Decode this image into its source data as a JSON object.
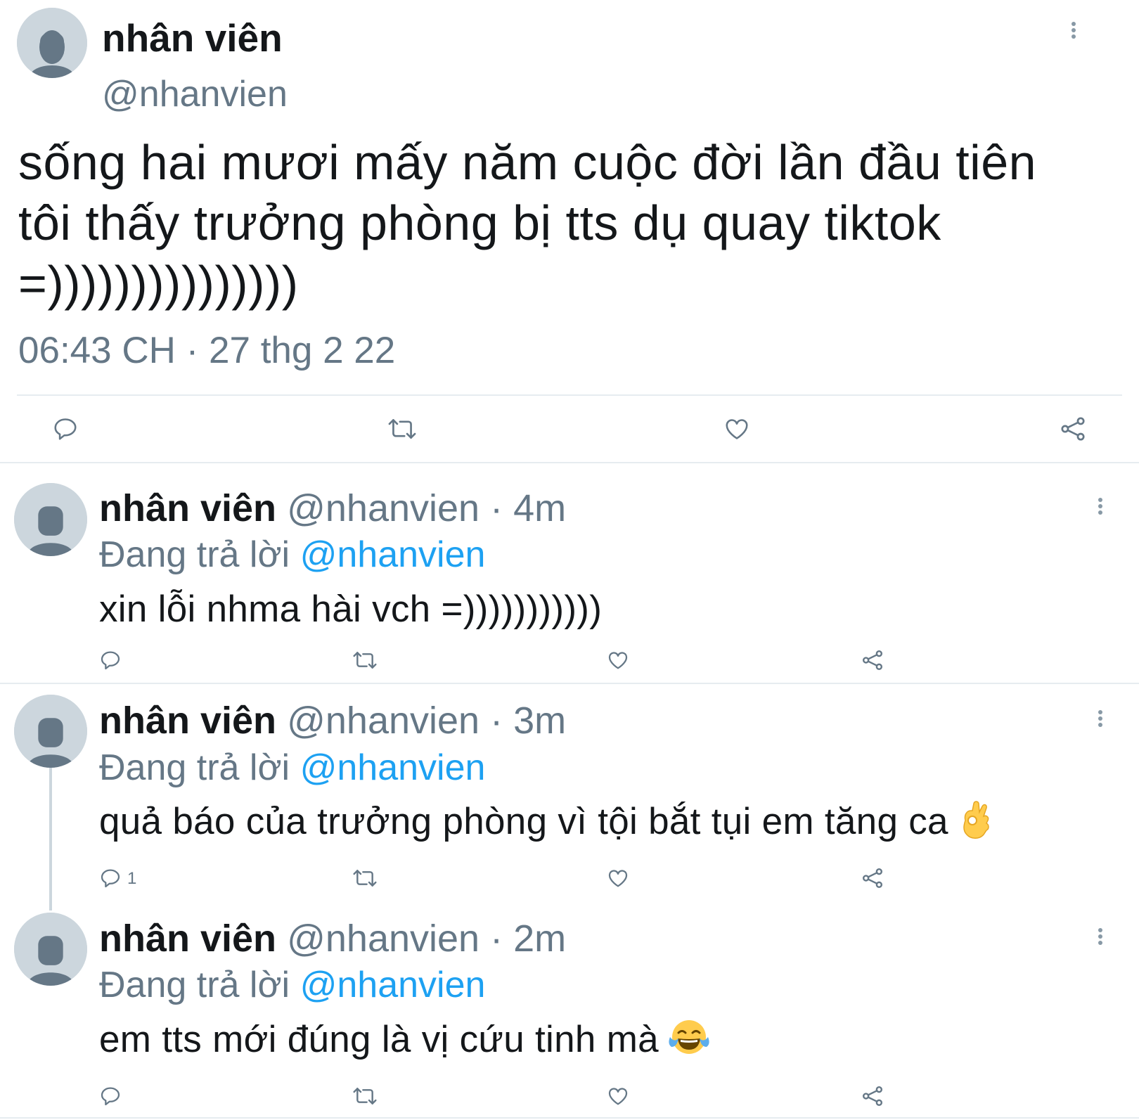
{
  "main_tweet": {
    "name": "nhân viên",
    "handle": "@nhanvien",
    "text_lines": [
      "sống hai mươi mấy năm cuộc đời lần đầu tiên",
      "tôi thấy trưởng phòng bị tts dụ quay tiktok",
      "=)))))))))))))))"
    ],
    "time": "06:43 CH",
    "separator": " · ",
    "date": "27 thg 2 22"
  },
  "replies": [
    {
      "name": "nhân viên",
      "handle": "@nhanvien",
      "separator": " · ",
      "time": "4m",
      "replying_label": "Đang trả lời",
      "replying_to": "@nhanvien",
      "text": "xin lỗi nhma hài vch =)))))))))))",
      "reply_count": ""
    },
    {
      "name": "nhân viên",
      "handle": "@nhanvien",
      "separator": " · ",
      "time": "3m",
      "replying_label": "Đang trả lời",
      "replying_to": "@nhanvien",
      "text": "quả báo của trưởng phòng vì tội bắt tụi em tăng ca",
      "emoji": "ok-hand-emoji",
      "reply_count": "1"
    },
    {
      "name": "nhân viên",
      "handle": "@nhanvien",
      "separator": " · ",
      "time": "2m",
      "replying_label": "Đang trả lời",
      "replying_to": "@nhanvien",
      "text": "em tts mới đúng là vị cứu tinh mà",
      "emoji": "tears-of-joy-emoji",
      "reply_count": ""
    }
  ],
  "icons": {
    "reply": "reply-icon",
    "retweet": "retweet-icon",
    "like": "heart-icon",
    "share": "share-icon",
    "more": "more-vertical-icon"
  },
  "colors": {
    "text_primary": "#14171a",
    "text_secondary": "#657786",
    "mention": "#1da1f2",
    "divider": "#e6ecf0",
    "avatar_bg": "#ccd6dd",
    "avatar_fg": "#657786"
  }
}
